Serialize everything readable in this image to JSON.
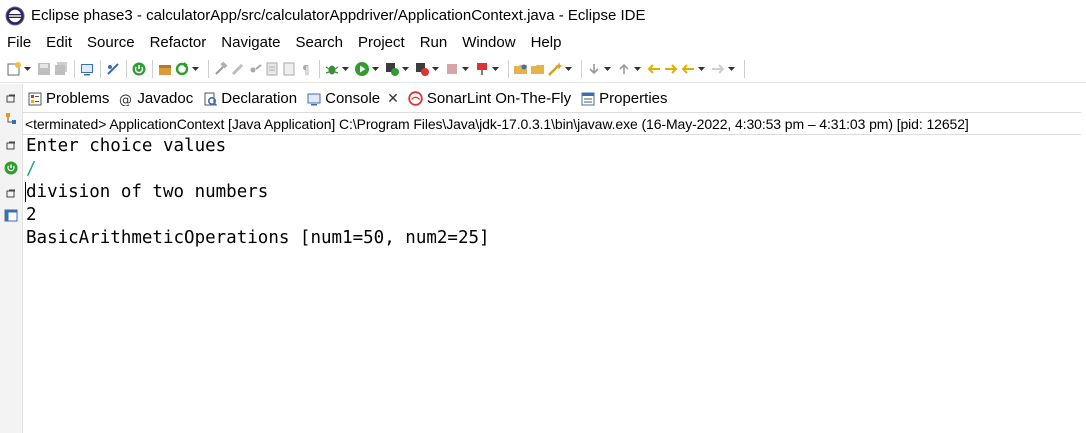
{
  "window": {
    "title": "Eclipse phase3 - calculatorApp/src/calculatorAppdriver/ApplicationContext.java - Eclipse IDE",
    "icon": "eclipse-icon"
  },
  "menu": [
    "File",
    "Edit",
    "Source",
    "Refactor",
    "Navigate",
    "Search",
    "Project",
    "Run",
    "Window",
    "Help"
  ],
  "tabs": [
    {
      "label": "Problems",
      "icon": "problems-icon"
    },
    {
      "label": "Javadoc",
      "icon": "javadoc-icon"
    },
    {
      "label": "Declaration",
      "icon": "declaration-icon"
    },
    {
      "label": "Console",
      "icon": "console-icon",
      "active": true,
      "close": "✕"
    },
    {
      "label": "SonarLint On-The-Fly",
      "icon": "sonarlint-icon"
    },
    {
      "label": "Properties",
      "icon": "properties-icon"
    }
  ],
  "console": {
    "status": "<terminated> ApplicationContext [Java Application] C:\\Program Files\\Java\\jdk-17.0.3.1\\bin\\javaw.exe  (16-May-2022, 4:30:53 pm – 4:31:03 pm) [pid: 12652]",
    "lines": [
      {
        "text": "Enter choice values",
        "type": "output"
      },
      {
        "text": "/",
        "type": "input"
      },
      {
        "text": "division of two numbers",
        "type": "output"
      },
      {
        "text": "2",
        "type": "output"
      },
      {
        "text": "BasicArithmeticOperations [num1=50, num2=25]",
        "type": "output"
      }
    ]
  },
  "colors": {
    "input_text": "#1aa68e",
    "run_green": "#2f9e2f",
    "accent_orange": "#e69b22"
  }
}
